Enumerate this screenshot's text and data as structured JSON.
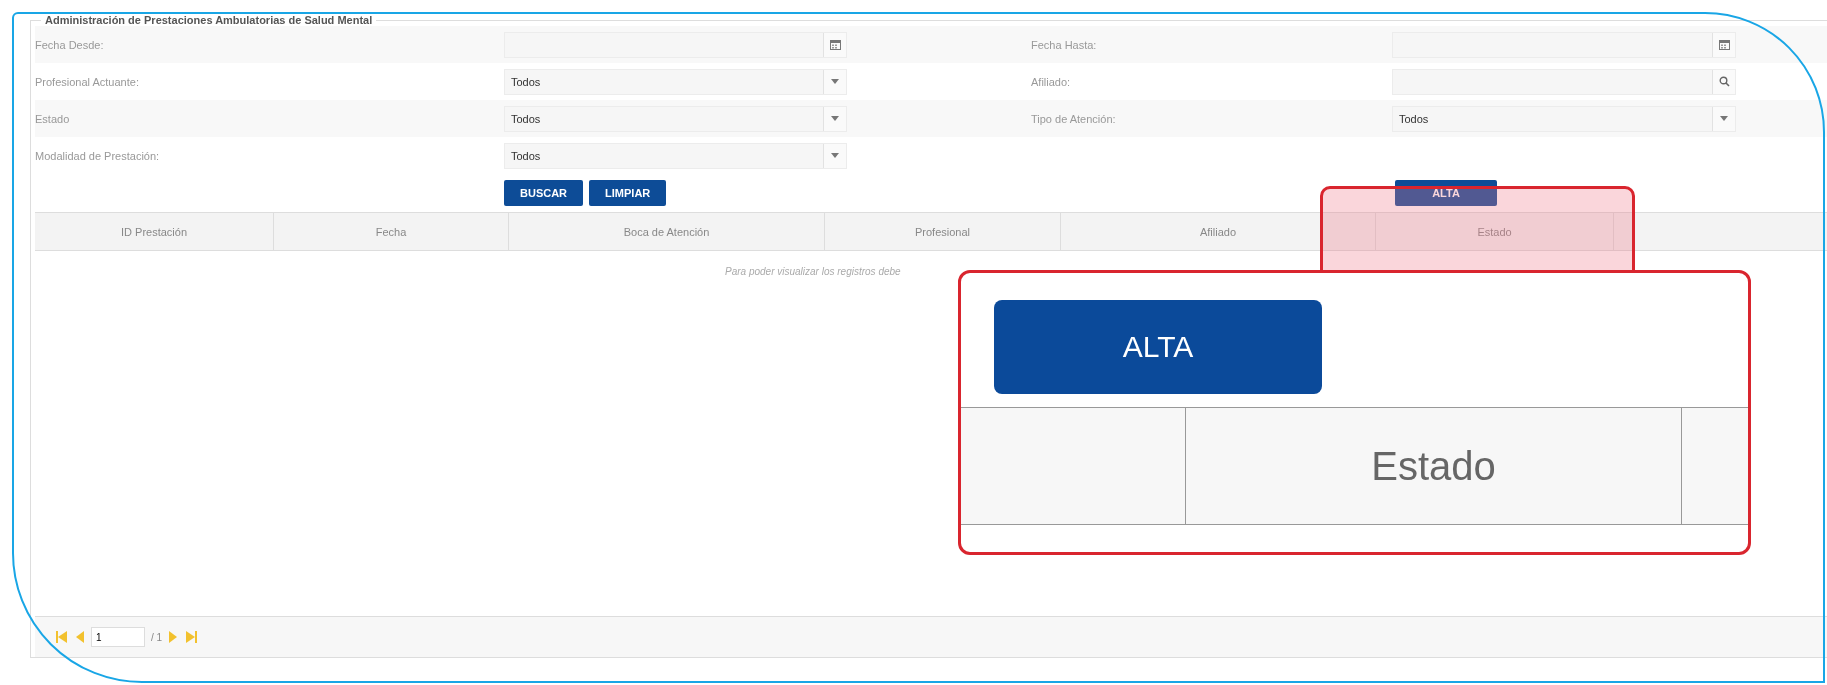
{
  "form_title": "Administración de Prestaciones Ambulatorias de Salud Mental",
  "filter_rows": [
    {
      "fields": [
        {
          "label": "Fecha Desde:",
          "kind": "date"
        },
        {
          "label": "Fecha Hasta:",
          "kind": "date"
        }
      ]
    },
    {
      "fields": [
        {
          "label": "Profesional Actuante:",
          "kind": "select",
          "value": "Todos"
        },
        {
          "label": "Afiliado:",
          "kind": "search"
        }
      ]
    },
    {
      "fields": [
        {
          "label": "Estado",
          "kind": "select",
          "value": "Todos"
        },
        {
          "label": "Tipo de Atención:",
          "kind": "select",
          "value": "Todos"
        }
      ]
    },
    {
      "fields": [
        {
          "label": "Modalidad de Prestación:",
          "kind": "select",
          "value": "Todos"
        }
      ]
    }
  ],
  "buttons": [
    "BUSCAR",
    "LIMPIAR"
  ],
  "alta_button": "ALTA",
  "table": {
    "columns": [
      "ID Prestación",
      "Fecha",
      "Boca de Atención",
      "Profesional",
      "Afiliado",
      "Estado"
    ],
    "message": "Para poder visualizar los registros debe"
  },
  "pagination": {
    "page": "1",
    "total": "/ 1"
  },
  "callout": {
    "button": "ALTA",
    "column": "Estado"
  }
}
